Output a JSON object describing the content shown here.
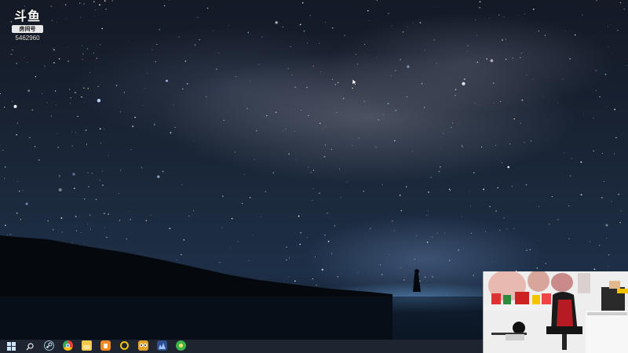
{
  "desktop": {
    "wallpaper": "starry-night-milky-way",
    "colors": {
      "sky": "#182232",
      "horizon_glow": "#6eaae6",
      "taskbar": "#1f2530"
    }
  },
  "watermark": {
    "logo_text": "斗鱼",
    "tag_text": "房间号",
    "room_number": "5462960"
  },
  "webcam": {
    "description_icon": "streamer-webcam"
  },
  "taskbar": {
    "items": [
      {
        "name": "start-button",
        "icon": "windows-logo-icon",
        "color": "#4aa3ff"
      },
      {
        "name": "search-button",
        "icon": "search-icon",
        "color": "#ffffff"
      },
      {
        "name": "steam-button",
        "icon": "steam-icon",
        "color": "#1b2838"
      },
      {
        "name": "chrome-button",
        "icon": "chrome-icon",
        "color": "#e94235"
      },
      {
        "name": "folder-button",
        "icon": "folder-icon",
        "color": "#f2c94c"
      },
      {
        "name": "orange-app-button",
        "icon": "orange-app-icon",
        "color": "#f08a24"
      },
      {
        "name": "circle-app-button",
        "icon": "ring-app-icon",
        "color": "#f1c40f"
      },
      {
        "name": "owl-app-button",
        "icon": "owl-icon",
        "color": "#e0a32a"
      },
      {
        "name": "blue-app-button",
        "icon": "blue-app-icon",
        "color": "#3a6fd8"
      },
      {
        "name": "green-app-button",
        "icon": "green-app-icon",
        "color": "#3cb44b"
      }
    ]
  }
}
